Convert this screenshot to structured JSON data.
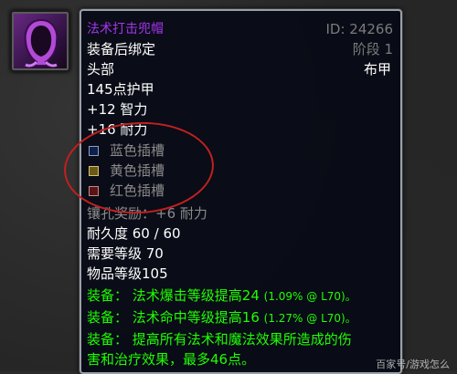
{
  "item": {
    "name": "法术打击兜帽",
    "id_label": "ID: 24266",
    "stage_label": "阶段 1",
    "bind": "装备后绑定",
    "slot": "头部",
    "armor_type": "布甲",
    "armor": "145点护甲",
    "stat_int": "+12 智力",
    "stat_sta": "+16 耐力",
    "sockets": [
      {
        "color": "blue",
        "label": "蓝色插槽"
      },
      {
        "color": "yellow",
        "label": "黄色插槽"
      },
      {
        "color": "red",
        "label": "红色插槽"
      }
    ],
    "socket_bonus": "镶孔奖励：+6 耐力",
    "durability": "耐久度 60 / 60",
    "req_level": "需要等级 70",
    "item_level": "物品等级105",
    "equip1_main": "装备： 法术爆击等级提高24",
    "equip1_sub": "(1.09% @ L70)。",
    "equip2_main": "装备： 法术命中等级提高16",
    "equip2_sub": "(1.27% @ L70)。",
    "equip3_line1": "装备： 提高所有法术和魔法效果所造成的伤",
    "equip3_line2": "害和治疗效果，最多46点。"
  },
  "watermark": "百家号/游戏怎么",
  "colors": {
    "epic": "#a335ee",
    "green": "#1eff00",
    "grey": "#8a8a8a",
    "annotation": "#c0211f"
  },
  "icons": {
    "item": "purple-hood-icon"
  }
}
